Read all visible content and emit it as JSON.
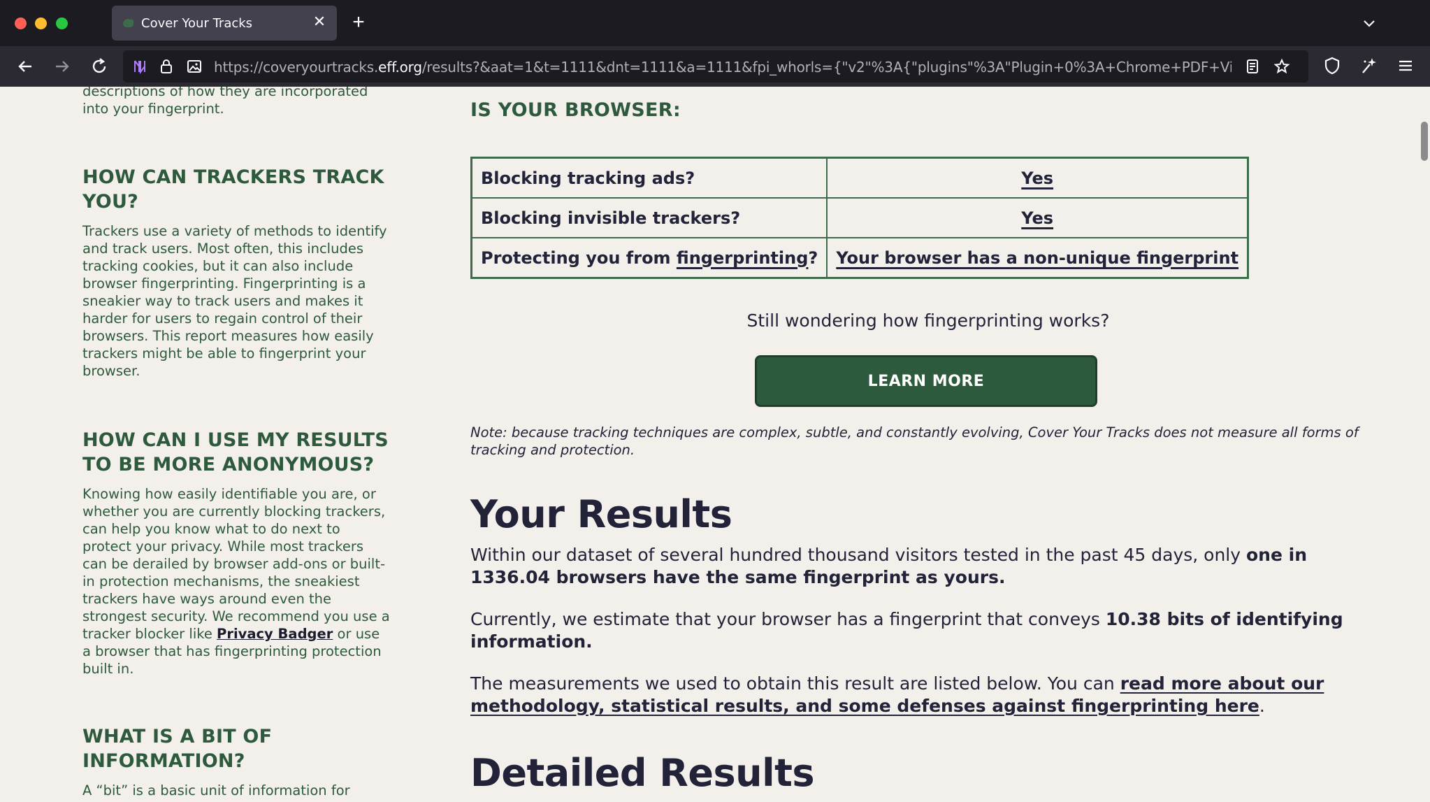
{
  "browser": {
    "tab_title": "Cover Your Tracks",
    "url_host_prefix": "https://coveryourtracks.",
    "url_host_domain": "eff.org",
    "url_path": "/results?&aat=1&t=1111&dnt=1111&a=1111&fpi_whorls={\"v2\"%3A{\"plugins\"%3A\"Plugin+0%3A+Chrome+PDF+Viewer%3B+Portab"
  },
  "sidebar": {
    "intro_tail": "descriptions of how they are incorporated into your fingerprint.",
    "section1_title": "HOW CAN TRACKERS TRACK YOU?",
    "section1_body": "Trackers use a variety of methods to identify and track users. Most often, this includes tracking cookies, but it can also include browser fingerprinting. Fingerprinting is a sneakier way to track users and makes it harder for users to regain control of their browsers. This report measures how easily trackers might be able to fingerprint your browser.",
    "section2_title": "HOW CAN I USE MY RESULTS TO BE MORE ANONYMOUS?",
    "section2_body_a": "Knowing how easily identifiable you are, or whether you are currently blocking trackers, can help you know what to do next to protect your privacy. While most trackers can be derailed by browser add-ons or built-in protection mechanisms, the sneakiest trackers have ways around even the strongest security. We recommend you use a tracker blocker like ",
    "section2_link": "Privacy Badger",
    "section2_body_b": " or use a browser that has fingerprinting protection built in.",
    "section3_title": "WHAT IS A BIT OF INFORMATION?",
    "section3_body": "A “bit” is a basic unit of information for"
  },
  "main": {
    "browser_heading": "IS YOUR BROWSER:",
    "rows": [
      {
        "question": "Blocking tracking ads?",
        "answer": "Yes"
      },
      {
        "question": "Blocking invisible trackers?",
        "answer": "Yes"
      },
      {
        "question_prefix": "Protecting you from ",
        "question_link": "fingerprinting",
        "question_suffix": "?",
        "answer": "Your browser has a non-unique fingerprint"
      }
    ],
    "wondering": "Still wondering how fingerprinting works?",
    "learn_more": "LEARN MORE",
    "note": "Note: because tracking techniques are complex, subtle, and constantly evolving, Cover Your Tracks does not measure all forms of tracking and protection.",
    "results_heading": "Your Results",
    "p1_a": "Within our dataset of several hundred thousand visitors tested in the past 45 days, only ",
    "p1_b": "one in 1336.04 browsers have the same fingerprint as yours.",
    "p2_a": "Currently, we estimate that your browser has a fingerprint that conveys ",
    "p2_b": "10.38 bits of identifying information.",
    "p3_a": "The measurements we used to obtain this result are listed below. You can ",
    "p3_link": "read more about our methodology, statistical results, and some defenses against fingerprinting here",
    "p3_b": ".",
    "detailed_heading": "Detailed Results"
  },
  "colors": {
    "green": "#2d5a3c",
    "page_bg": "#f3efeb",
    "ink": "#222238"
  }
}
